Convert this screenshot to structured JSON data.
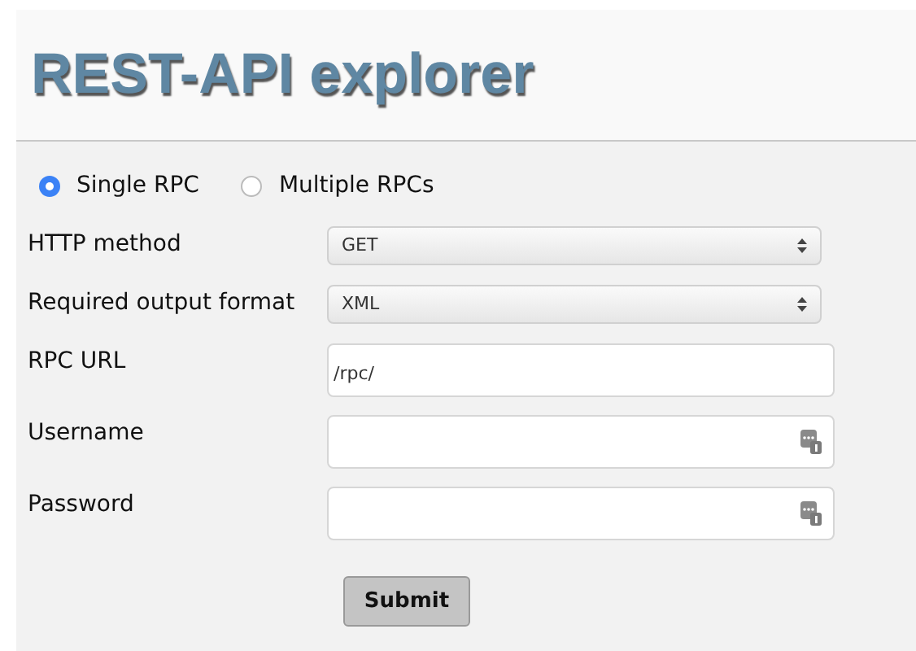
{
  "header": {
    "title": "REST-API explorer"
  },
  "modes": [
    {
      "label": "Single RPC",
      "selected": true
    },
    {
      "label": "Multiple RPCs",
      "selected": false
    }
  ],
  "fields": [
    {
      "kind": "select",
      "label": "HTTP method",
      "value": "GET"
    },
    {
      "kind": "select",
      "label": "Required output format",
      "value": "XML"
    },
    {
      "kind": "text",
      "label": "RPC URL",
      "value": "/rpc/"
    },
    {
      "kind": "credential",
      "label": "Username"
    },
    {
      "kind": "credential",
      "label": "Password"
    }
  ],
  "submit": {
    "label": "Submit"
  }
}
